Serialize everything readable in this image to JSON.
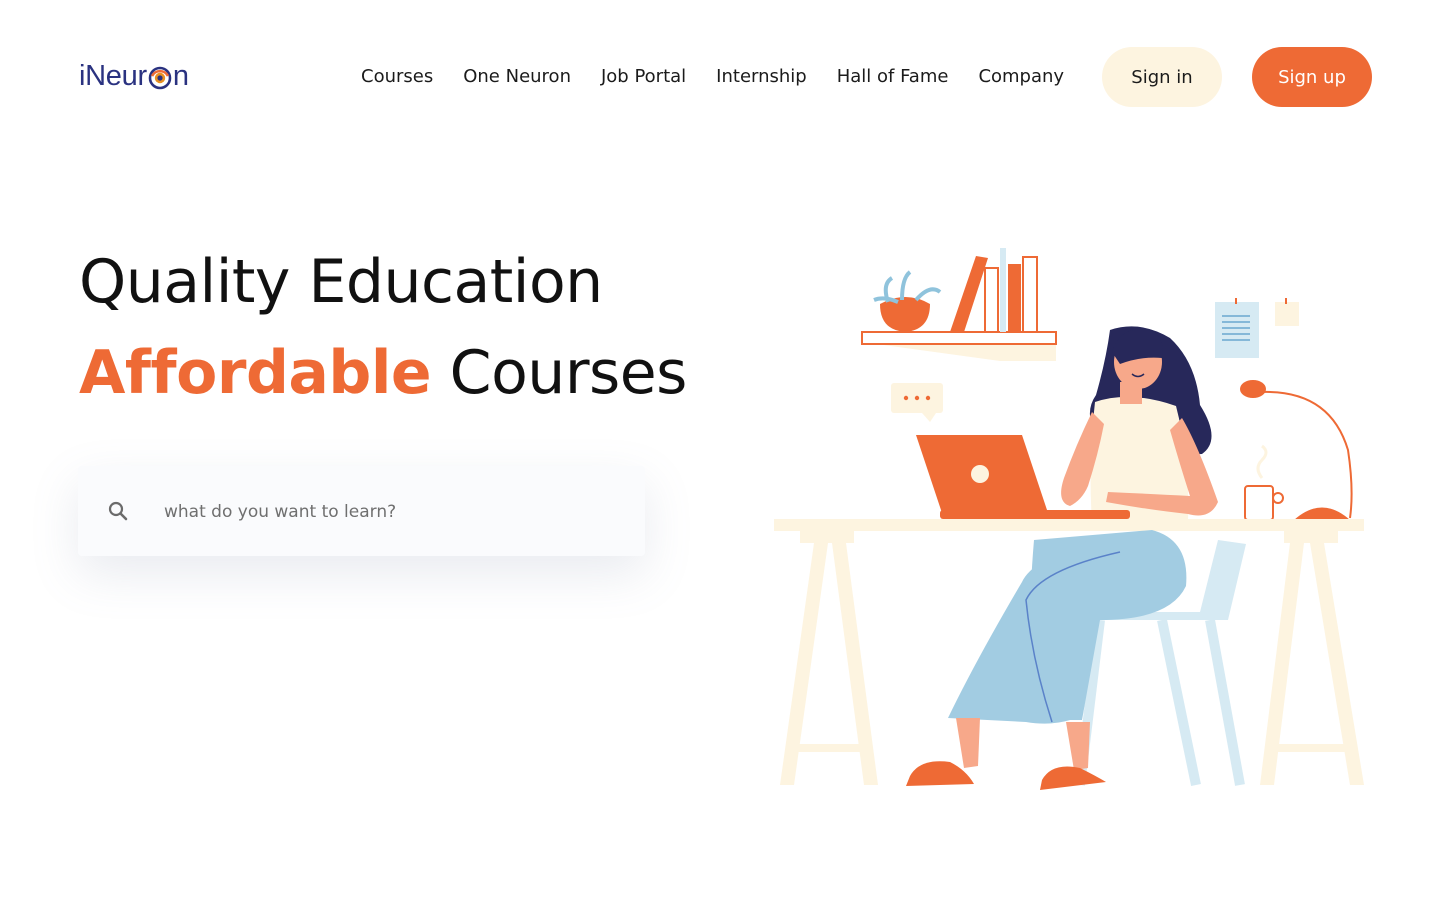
{
  "brand": {
    "name_prefix": "iNeur",
    "name_suffix": "n",
    "primary": "#2a3280",
    "accent": "#ee6a35"
  },
  "nav": {
    "items": [
      "Courses",
      "One Neuron",
      "Job Portal",
      "Internship",
      "Hall of Fame",
      "Company"
    ]
  },
  "auth": {
    "signin_label": "Sign in",
    "signup_label": "Sign up"
  },
  "hero": {
    "line1": "Quality Education",
    "line2_accent": "Affordable",
    "line2_rest": " Courses"
  },
  "search": {
    "placeholder": "what do you want to learn?",
    "icon": "search-icon"
  },
  "illustration": {
    "icon": "woman-at-desk-illustration"
  }
}
